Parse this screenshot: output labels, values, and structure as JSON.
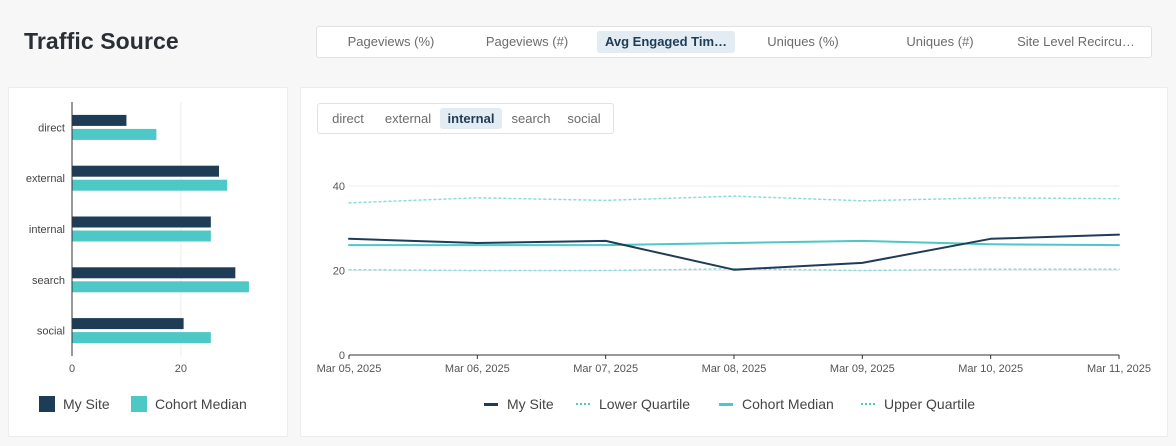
{
  "page": {
    "title": "Traffic Source"
  },
  "metric_tabs": {
    "items": [
      "Pageviews (%)",
      "Pageviews (#)",
      "Avg Engaged Tim…",
      "Uniques (%)",
      "Uniques (#)",
      "Site Level Recircu…"
    ],
    "active": "Avg Engaged Tim…"
  },
  "source_tabs": {
    "items": [
      "direct",
      "external",
      "internal",
      "search",
      "social"
    ],
    "active": "internal"
  },
  "colors": {
    "my_site": "#1f3c57",
    "cohort": "#4ec7c7",
    "quartile": "#8fdcdc"
  },
  "chart_data": [
    {
      "type": "bar",
      "orientation": "horizontal",
      "categories": [
        "direct",
        "external",
        "internal",
        "search",
        "social"
      ],
      "series": [
        {
          "name": "My Site",
          "values": [
            10,
            27,
            25.5,
            30,
            20.5
          ]
        },
        {
          "name": "Cohort Median",
          "values": [
            15.5,
            28.5,
            25.5,
            32.5,
            25.5
          ]
        }
      ],
      "xticks": [
        0,
        20
      ],
      "xlim": [
        0,
        36
      ],
      "legend": "bottom"
    },
    {
      "type": "line",
      "x": [
        "Mar 05, 2025",
        "Mar 06, 2025",
        "Mar 07, 2025",
        "Mar 08, 2025",
        "Mar 09, 2025",
        "Mar 10, 2025",
        "Mar 11, 2025"
      ],
      "series": [
        {
          "name": "My Site",
          "style": "solid",
          "values": [
            27.5,
            26.5,
            27,
            20.2,
            21.8,
            27.5,
            28.5
          ]
        },
        {
          "name": "Lower Quartile",
          "style": "dotted",
          "values": [
            20.2,
            20.0,
            20.0,
            20.4,
            20.0,
            20.3,
            20.3
          ]
        },
        {
          "name": "Cohort Median",
          "style": "solid",
          "values": [
            26,
            26,
            26,
            26.5,
            27,
            26.2,
            26
          ]
        },
        {
          "name": "Upper Quartile",
          "style": "dotted",
          "values": [
            36,
            37.2,
            36.6,
            37.6,
            36.5,
            37.2,
            37
          ]
        }
      ],
      "yticks": [
        0,
        20,
        40
      ],
      "ylim": [
        0,
        40
      ],
      "grid": true,
      "legend": "bottom"
    }
  ]
}
